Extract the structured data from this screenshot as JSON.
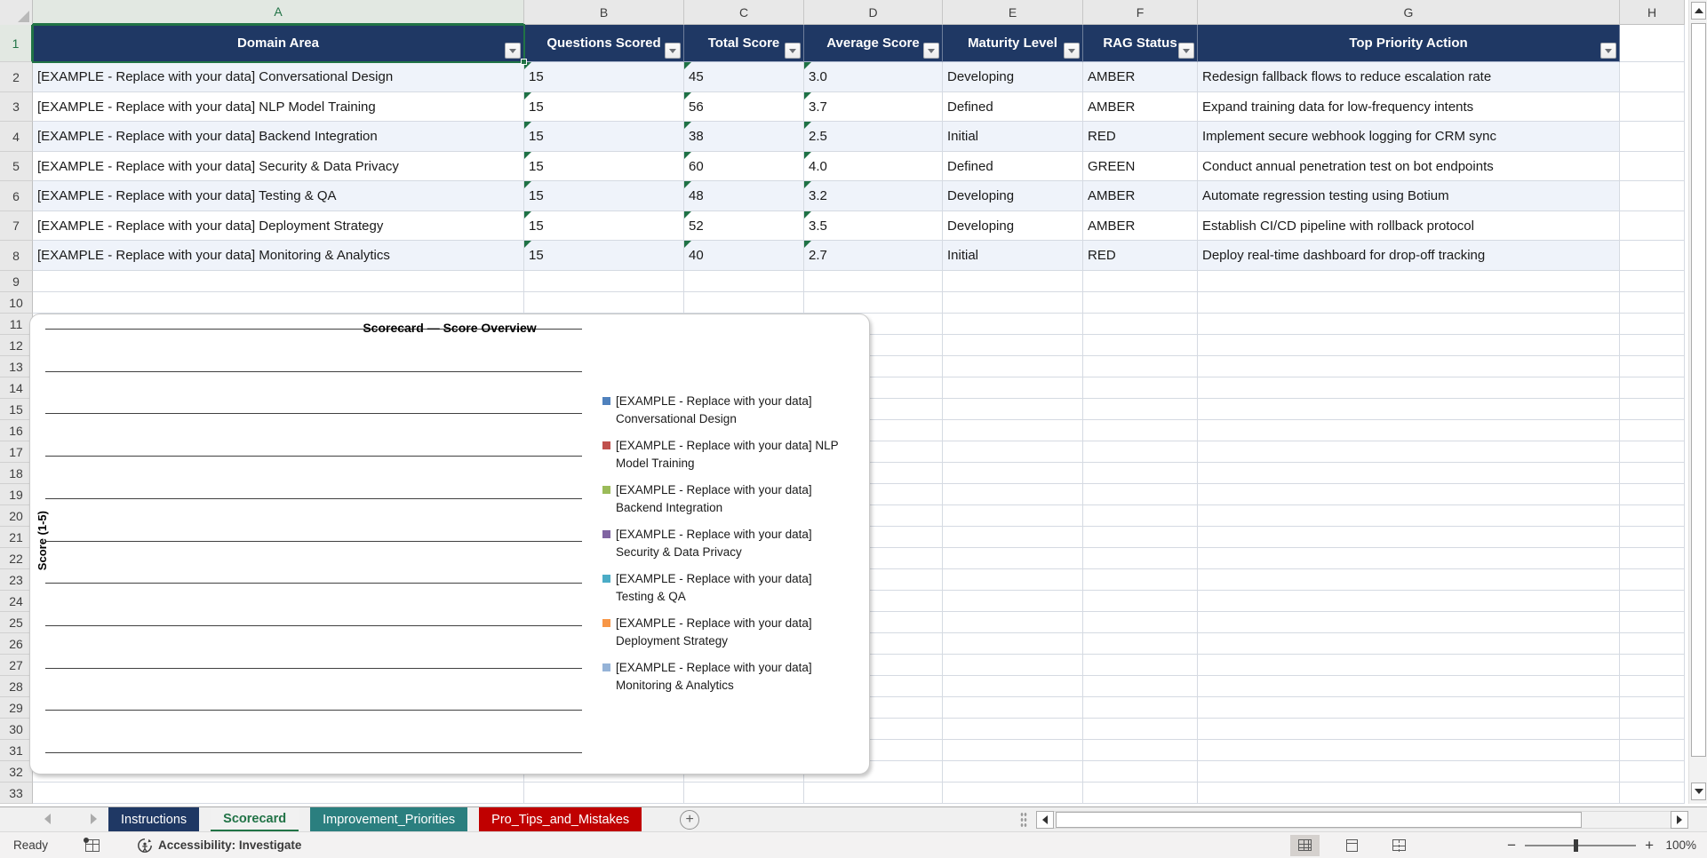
{
  "grid": {
    "columns": [
      "A",
      "B",
      "C",
      "D",
      "E",
      "F",
      "G",
      "H"
    ],
    "row_numbers": [
      1,
      2,
      3,
      4,
      5,
      6,
      7,
      8,
      9,
      10,
      11,
      12,
      13,
      14,
      15,
      16,
      17,
      18,
      19,
      20,
      21,
      22,
      23,
      24,
      25,
      26,
      27,
      28,
      29,
      30,
      31,
      32,
      33
    ],
    "selected_cell": "A1",
    "selected_column": "A",
    "selected_row": 1
  },
  "table": {
    "headers": [
      "Domain Area",
      "Questions Scored",
      "Total Score",
      "Average Score",
      "Maturity Level",
      "RAG Status",
      "Top Priority Action"
    ],
    "rows": [
      [
        "[EXAMPLE - Replace with your data] Conversational Design",
        "15",
        "45",
        "3.0",
        "Developing",
        "AMBER",
        "Redesign fallback flows to reduce escalation rate"
      ],
      [
        "[EXAMPLE - Replace with your data] NLP Model Training",
        "15",
        "56",
        "3.7",
        "Defined",
        "AMBER",
        "Expand training data for low-frequency intents"
      ],
      [
        "[EXAMPLE - Replace with your data] Backend Integration",
        "15",
        "38",
        "2.5",
        "Initial",
        "RED",
        "Implement secure webhook logging for CRM sync"
      ],
      [
        "[EXAMPLE - Replace with your data] Security & Data Privacy",
        "15",
        "60",
        "4.0",
        "Defined",
        "GREEN",
        "Conduct annual penetration test on bot endpoints"
      ],
      [
        "[EXAMPLE - Replace with your data] Testing & QA",
        "15",
        "48",
        "3.2",
        "Developing",
        "AMBER",
        "Automate regression testing using Botium"
      ],
      [
        "[EXAMPLE - Replace with your data] Deployment Strategy",
        "15",
        "52",
        "3.5",
        "Developing",
        "AMBER",
        "Establish CI/CD pipeline with rollback protocol"
      ],
      [
        "[EXAMPLE - Replace with your data] Monitoring & Analytics",
        "15",
        "40",
        "2.7",
        "Initial",
        "RED",
        "Deploy real-time dashboard for drop-off tracking"
      ]
    ],
    "error_marker_columns": [
      1,
      2,
      3
    ],
    "header_fill": "#1F3864",
    "banded_row_fill": "#EFF3FA"
  },
  "chart_data": {
    "type": "bar",
    "title": "Scorecard — Score Overview",
    "ylabel": "Score (1-5)",
    "ylim": [
      0,
      5
    ],
    "gridline_count": 11,
    "grid": true,
    "legend_position": "right",
    "plot_empty": true,
    "series": [
      {
        "name": "[EXAMPLE - Replace with your data] Conversational Design",
        "legend_lines": [
          "[EXAMPLE - Replace with your data]",
          "Conversational Design"
        ],
        "color": "#4F81BD",
        "values": []
      },
      {
        "name": "[EXAMPLE - Replace with your data] NLP Model Training",
        "legend_lines": [
          "[EXAMPLE - Replace with your data] NLP",
          "Model Training"
        ],
        "color": "#C0504D",
        "values": []
      },
      {
        "name": "[EXAMPLE - Replace with your data] Backend Integration",
        "legend_lines": [
          "[EXAMPLE - Replace with your data]",
          "Backend Integration"
        ],
        "color": "#9BBB59",
        "values": []
      },
      {
        "name": "[EXAMPLE - Replace with your data] Security & Data Privacy",
        "legend_lines": [
          "[EXAMPLE - Replace with your data]",
          "Security & Data Privacy"
        ],
        "color": "#8064A2",
        "values": []
      },
      {
        "name": "[EXAMPLE - Replace with your data] Testing & QA",
        "legend_lines": [
          "[EXAMPLE - Replace with your data]",
          "Testing & QA"
        ],
        "color": "#4BACC6",
        "values": []
      },
      {
        "name": "[EXAMPLE - Replace with your data] Deployment Strategy",
        "legend_lines": [
          "[EXAMPLE - Replace with your data]",
          "Deployment Strategy"
        ],
        "color": "#F79646",
        "values": []
      },
      {
        "name": "[EXAMPLE - Replace with your data] Monitoring & Analytics",
        "legend_lines": [
          "[EXAMPLE - Replace with your data]",
          "Monitoring & Analytics"
        ],
        "color": "#95B3D7",
        "values": []
      }
    ]
  },
  "sheet_tabs": {
    "tabs": [
      {
        "label": "Instructions",
        "fill": "#1F3864",
        "text_color": "#FFFFFF",
        "active": false
      },
      {
        "label": "Scorecard",
        "fill": "#F1F1F1",
        "text_color": "#217346",
        "active": true
      },
      {
        "label": "Improvement_Priorities",
        "fill": "#2B7F7F",
        "text_color": "#FFFFFF",
        "active": false
      },
      {
        "label": "Pro_Tips_and_Mistakes",
        "fill": "#C00000",
        "text_color": "#FFFFFF",
        "active": false
      }
    ],
    "add_sheet_label": "+"
  },
  "status_bar": {
    "mode": "Ready",
    "accessibility_label": "Accessibility: Investigate",
    "zoom_level": "100%"
  },
  "colors": {
    "selection_green": "#217346",
    "header_navy": "#1F3864"
  }
}
